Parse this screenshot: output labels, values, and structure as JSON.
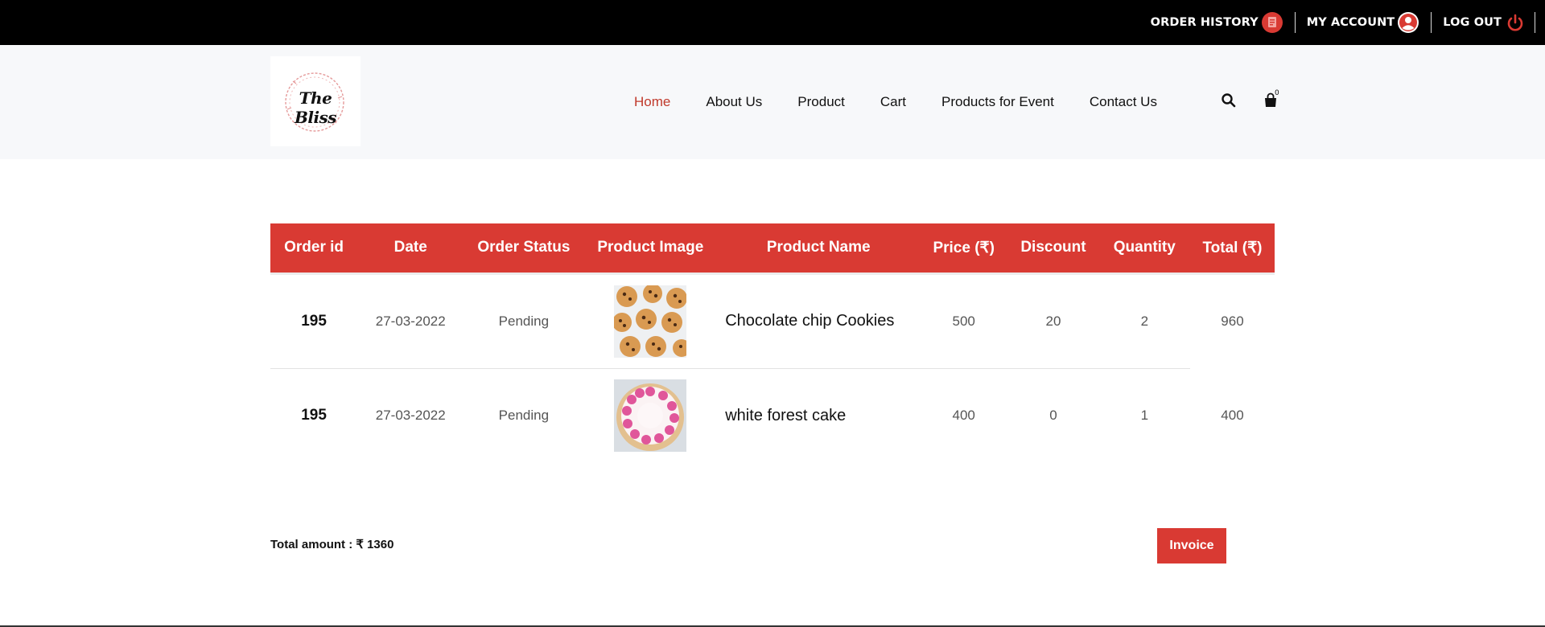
{
  "topbar": {
    "order_history": "ORDER HISTORY",
    "my_account": "MY ACCOUNT",
    "log_out": "LOG OUT"
  },
  "brand": {
    "logo_text": "The Bliss"
  },
  "nav": {
    "items": [
      "Home",
      "About Us",
      "Product",
      "Cart",
      "Products for Event",
      "Contact Us"
    ],
    "active": "Home",
    "cart_count": "0"
  },
  "table": {
    "headers": [
      "Order id",
      "Date",
      "Order Status",
      "Product Image",
      "Product Name",
      "Price (₹)",
      "Discount",
      "Quantity",
      "Total (₹)"
    ],
    "rows": [
      {
        "order_id": "195",
        "date": "27-03-2022",
        "status": "Pending",
        "image": "cookies-image",
        "product_name": "Chocolate chip Cookies",
        "price": "500",
        "discount": "20",
        "quantity": "2",
        "total": "960"
      },
      {
        "order_id": "195",
        "date": "27-03-2022",
        "status": "Pending",
        "image": "pink-rose-cake-image",
        "product_name": "white forest cake",
        "price": "400",
        "discount": "0",
        "quantity": "1",
        "total": "400"
      }
    ]
  },
  "summary": {
    "total_label": "Total amount : ₹ 1360"
  },
  "actions": {
    "invoice_label": "Invoice"
  },
  "colors": {
    "accent": "#d93a33",
    "topbar": "#000000",
    "header_bg": "#f7f8fa"
  }
}
